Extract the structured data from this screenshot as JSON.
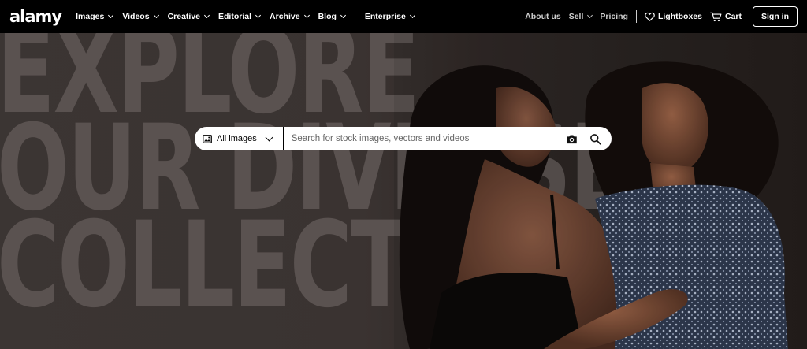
{
  "brand": {
    "logo": "alamy"
  },
  "nav": {
    "left": [
      {
        "label": "Images"
      },
      {
        "label": "Videos"
      },
      {
        "label": "Creative"
      },
      {
        "label": "Editorial"
      },
      {
        "label": "Archive"
      },
      {
        "label": "Blog"
      }
    ],
    "enterprise": "Enterprise",
    "right": {
      "about": "About us",
      "sell": "Sell",
      "pricing": "Pricing",
      "lightboxes": "Lightboxes",
      "cart": "Cart",
      "signin": "Sign in"
    }
  },
  "hero": {
    "lines": [
      "EXPLORE",
      "OUR DIVERSE",
      "COLLECTION"
    ]
  },
  "search": {
    "filter_label": "All images",
    "placeholder": "Search for stock images, vectors and videos"
  },
  "icons": {
    "image": "image-icon",
    "camera": "camera-icon",
    "search": "search-icon",
    "heart": "heart-icon",
    "cart": "cart-icon"
  }
}
